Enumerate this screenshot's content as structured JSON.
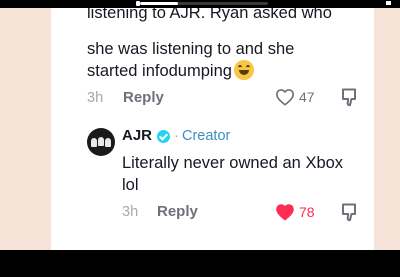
{
  "video": {
    "progress": 0.3
  },
  "comment": {
    "text_cutoff": "listening to AJR. Ryan asked who",
    "text_line2": "she was listening to and she",
    "text_line3": "started infodumping",
    "emoji": "laughing-with-tears",
    "time": "3h",
    "reply_label": "Reply",
    "likes": "47",
    "liked": false
  },
  "reply": {
    "author": "AJR",
    "verified": true,
    "separator": "·",
    "badge": "Creator",
    "text_line1": "Literally never owned an Xbox",
    "text_line2": "lol",
    "time": "3h",
    "reply_label": "Reply",
    "likes": "78",
    "liked": true
  },
  "colors": {
    "accent_like": "#fe2c55",
    "creator_badge": "#3b8fbf",
    "verified_badge": "#20d5ec",
    "background_peach": "#f6e3d8"
  }
}
